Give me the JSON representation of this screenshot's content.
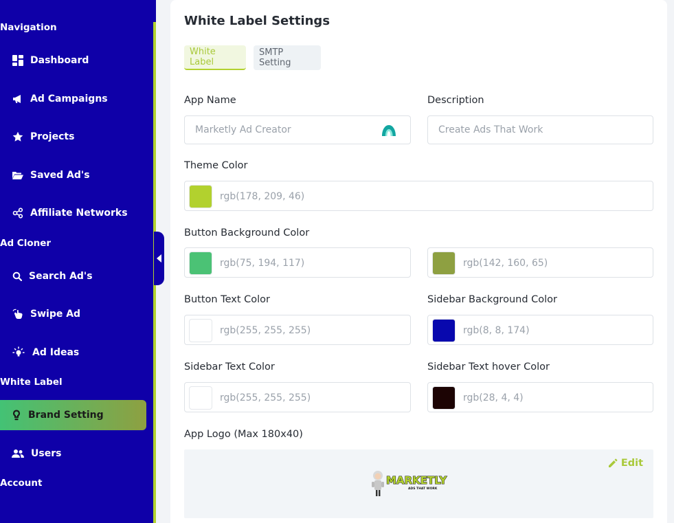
{
  "sidebar": {
    "sections": {
      "navigation": "Navigation",
      "ad_cloner": "Ad Cloner",
      "white_label": "White Label",
      "account": "Account"
    },
    "items": {
      "dashboard": "Dashboard",
      "ad_campaigns": "Ad Campaigns",
      "projects": "Projects",
      "saved_ads": "Saved Ad's",
      "affiliate_networks": "Affiliate Networks",
      "search_ads": "Search Ad's",
      "swipe_ad": "Swipe Ad",
      "ad_ideas": "Ad Ideas",
      "brand_setting": "Brand Setting",
      "users": "Users"
    },
    "active_item": "brand_setting",
    "colors": {
      "background": "#0f00a8",
      "accent": "#b2d12e"
    }
  },
  "page": {
    "title": "White Label Settings",
    "tabs": {
      "white_label": "White Label",
      "smtp": "SMTP Setting"
    },
    "active_tab": "white_label"
  },
  "form": {
    "app_name": {
      "label": "App Name",
      "placeholder": "Marketly Ad Creator"
    },
    "description": {
      "label": "Description",
      "placeholder": "Create Ads That Work"
    },
    "theme_color": {
      "label": "Theme Color",
      "value": "rgb(178, 209, 46)",
      "swatch": "#b2d12e"
    },
    "button_bg_color": {
      "label": "Button Background Color",
      "start": {
        "value": "rgb(75, 194, 117)",
        "swatch": "#4bc275"
      },
      "end": {
        "value": "rgb(142, 160, 65)",
        "swatch": "#8ea041"
      }
    },
    "button_text_color": {
      "label": "Button Text Color",
      "value": "rgb(255, 255, 255)",
      "swatch": "#ffffff"
    },
    "sidebar_bg_color": {
      "label": "Sidebar Background Color",
      "value": "rgb(8, 8, 174)",
      "swatch": "#0808ae"
    },
    "sidebar_text_color": {
      "label": "Sidebar Text Color",
      "value": "rgb(255, 255, 255)",
      "swatch": "#ffffff"
    },
    "sidebar_text_hover_color": {
      "label": "Sidebar Text hover Color",
      "value": "rgb(28, 4, 4)",
      "swatch": "#1c0404"
    },
    "app_logo": {
      "label": "App Logo (Max 180x40)",
      "edit_label": "Edit",
      "logo_text": "MARKETLY",
      "logo_tagline": "ADS THAT WORK"
    }
  }
}
